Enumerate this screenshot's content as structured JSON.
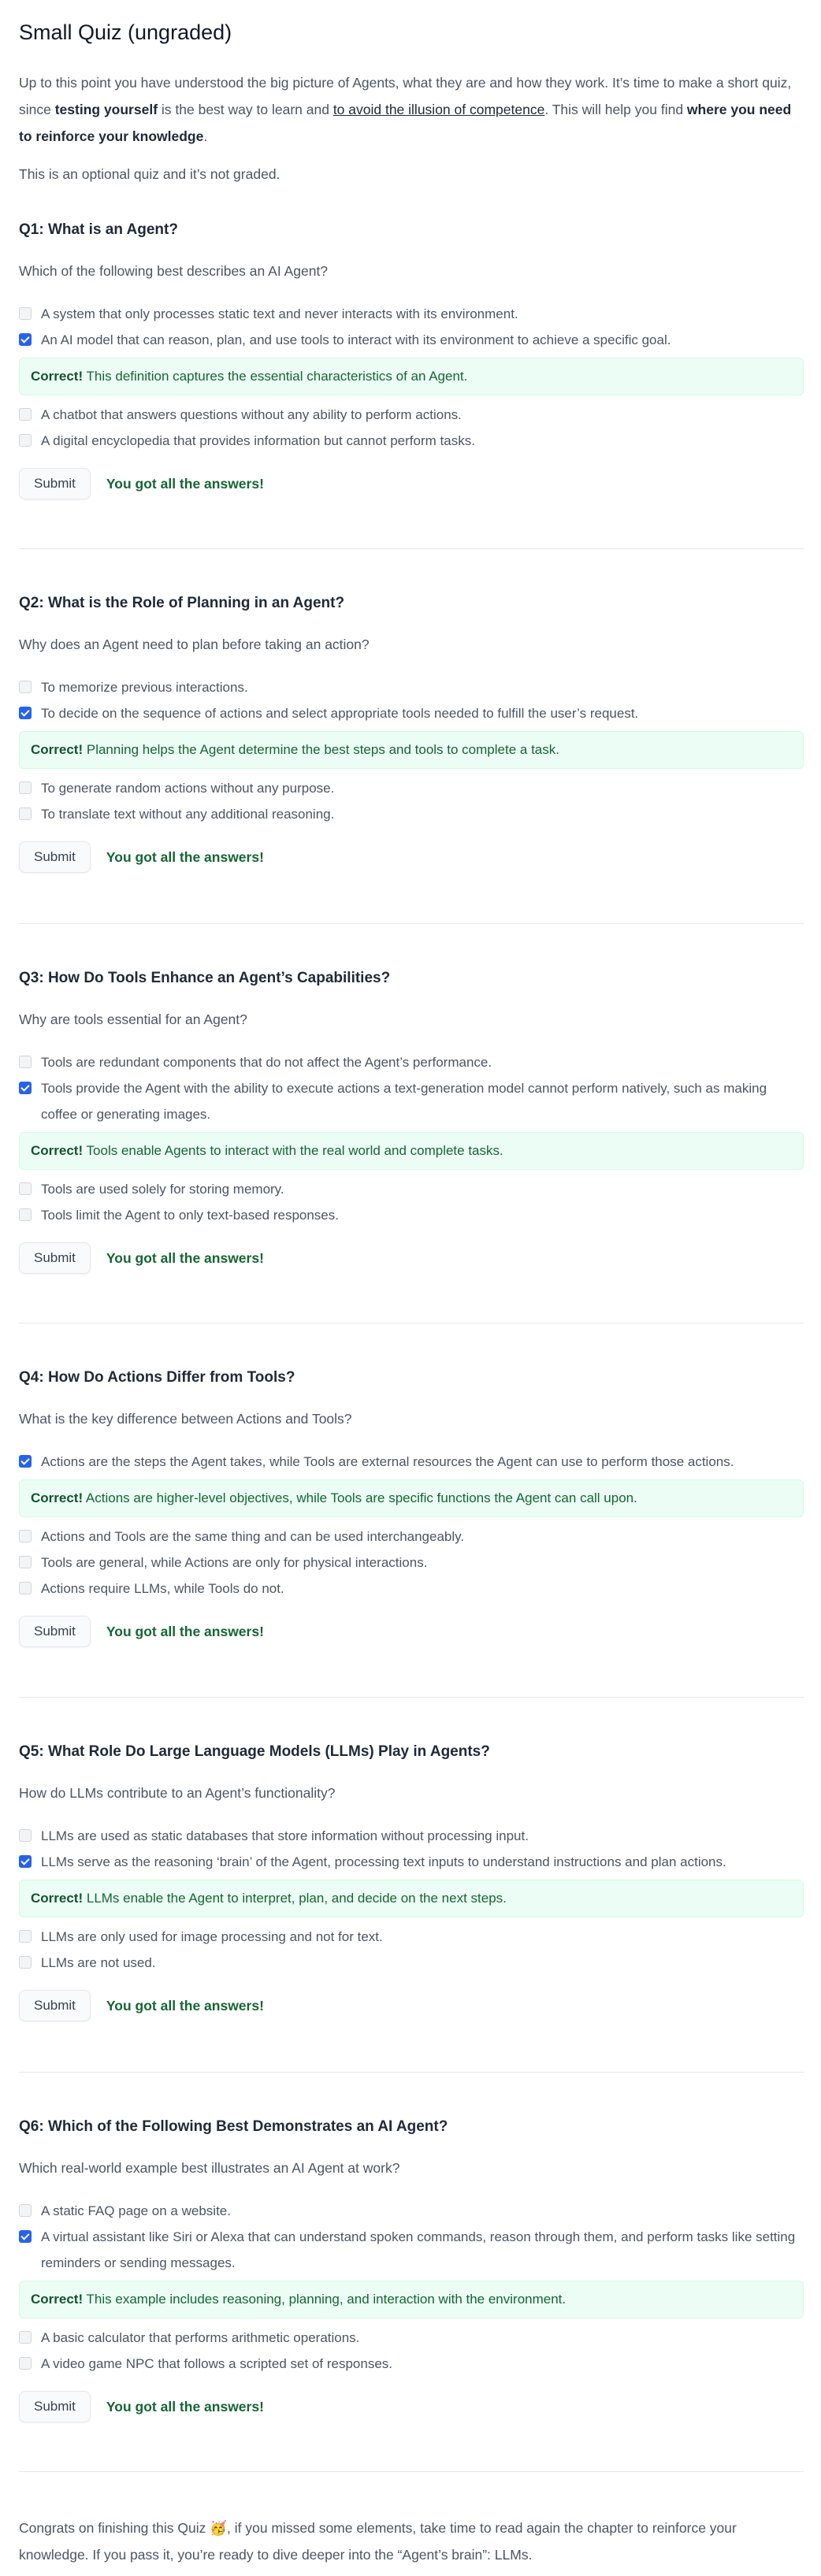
{
  "page": {
    "title": "Small Quiz (ungraded)",
    "intro": {
      "part1": "Up to this point you have understood the big picture of Agents, what they are and how they work. It’s time to make a short quiz, since ",
      "bold1": "testing yourself",
      "part2": " is the best way to learn and ",
      "underline1": "to avoid the illusion of competence",
      "part3": ". This will help you find ",
      "bold2": "where you need to reinforce your knowledge",
      "part4": "."
    },
    "optional_note": "This is an optional quiz and it’s not graded.",
    "submit_label": "Submit",
    "result_text": "You got all the answers!",
    "correct_label": "Correct!"
  },
  "quizzes": [
    {
      "title": "Q1: What is an Agent?",
      "question": "Which of the following best describes an AI Agent?",
      "choices": [
        {
          "text": "A system that only processes static text and never interacts with its environment.",
          "checked": false
        },
        {
          "text": "An AI model that can reason, plan, and use tools to interact with its environment to achieve a specific goal.",
          "checked": true
        },
        {
          "text": "A chatbot that answers questions without any ability to perform actions.",
          "checked": false
        },
        {
          "text": "A digital encyclopedia that provides information but cannot perform tasks.",
          "checked": false
        }
      ],
      "feedback": "This definition captures the essential characteristics of an Agent."
    },
    {
      "title": "Q2: What is the Role of Planning in an Agent?",
      "question": "Why does an Agent need to plan before taking an action?",
      "choices": [
        {
          "text": "To memorize previous interactions.",
          "checked": false
        },
        {
          "text": "To decide on the sequence of actions and select appropriate tools needed to fulfill the user’s request.",
          "checked": true
        },
        {
          "text": "To generate random actions without any purpose.",
          "checked": false
        },
        {
          "text": "To translate text without any additional reasoning.",
          "checked": false
        }
      ],
      "feedback": "Planning helps the Agent determine the best steps and tools to complete a task."
    },
    {
      "title": "Q3: How Do Tools Enhance an Agent’s Capabilities?",
      "question": "Why are tools essential for an Agent?",
      "choices": [
        {
          "text": "Tools are redundant components that do not affect the Agent’s performance.",
          "checked": false
        },
        {
          "text": "Tools provide the Agent with the ability to execute actions a text-generation model cannot perform natively, such as making coffee or generating images.",
          "checked": true
        },
        {
          "text": "Tools are used solely for storing memory.",
          "checked": false
        },
        {
          "text": "Tools limit the Agent to only text-based responses.",
          "checked": false
        }
      ],
      "feedback": "Tools enable Agents to interact with the real world and complete tasks."
    },
    {
      "title": "Q4: How Do Actions Differ from Tools?",
      "question": "What is the key difference between Actions and Tools?",
      "choices": [
        {
          "text": "Actions are the steps the Agent takes, while Tools are external resources the Agent can use to perform those actions.",
          "checked": true
        },
        {
          "text": "Actions and Tools are the same thing and can be used interchangeably.",
          "checked": false
        },
        {
          "text": "Tools are general, while Actions are only for physical interactions.",
          "checked": false
        },
        {
          "text": "Actions require LLMs, while Tools do not.",
          "checked": false
        }
      ],
      "feedback": "Actions are higher-level objectives, while Tools are specific functions the Agent can call upon."
    },
    {
      "title": "Q5: What Role Do Large Language Models (LLMs) Play in Agents?",
      "question": "How do LLMs contribute to an Agent’s functionality?",
      "choices": [
        {
          "text": "LLMs are used as static databases that store information without processing input.",
          "checked": false
        },
        {
          "text": "LLMs serve as the reasoning ‘brain’ of the Agent, processing text inputs to understand instructions and plan actions.",
          "checked": true
        },
        {
          "text": "LLMs are only used for image processing and not for text.",
          "checked": false
        },
        {
          "text": "LLMs are not used.",
          "checked": false
        }
      ],
      "feedback": "LLMs enable the Agent to interpret, plan, and decide on the next steps."
    },
    {
      "title": "Q6: Which of the Following Best Demonstrates an AI Agent?",
      "question": "Which real-world example best illustrates an AI Agent at work?",
      "choices": [
        {
          "text": "A static FAQ page on a website.",
          "checked": false
        },
        {
          "text": "A virtual assistant like Siri or Alexa that can understand spoken commands, reason through them, and perform tasks like setting reminders or sending messages.",
          "checked": true
        },
        {
          "text": "A basic calculator that performs arithmetic operations.",
          "checked": false
        },
        {
          "text": "A video game NPC that follows a scripted set of responses.",
          "checked": false
        }
      ],
      "feedback": "This example includes reasoning, planning, and interaction with the environment."
    }
  ],
  "congrats": "Congrats on finishing this Quiz 🥳, if you missed some elements, take time to read again the chapter to reinforce your knowledge. If you pass it, you’re ready to dive deeper into the “Agent’s brain”: LLMs."
}
